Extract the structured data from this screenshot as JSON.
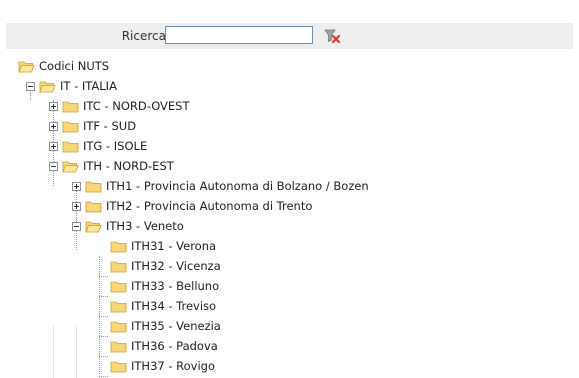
{
  "search": {
    "label": "Ricerca",
    "value": "",
    "placeholder": "",
    "clear_icon": "clear-filter-icon"
  },
  "tree": {
    "root": "Codici NUTS",
    "nodes": [
      {
        "label": "IT - ITALIA",
        "level": 1,
        "state": "expanded"
      },
      {
        "label": "ITC - NORD-OVEST",
        "level": 2,
        "state": "collapsed"
      },
      {
        "label": "ITF - SUD",
        "level": 2,
        "state": "collapsed"
      },
      {
        "label": "ITG - ISOLE",
        "level": 2,
        "state": "collapsed"
      },
      {
        "label": "ITH - NORD-EST",
        "level": 2,
        "state": "expanded"
      },
      {
        "label": "ITH1 - Provincia Autonoma di Bolzano / Bozen",
        "level": 3,
        "state": "collapsed"
      },
      {
        "label": "ITH2 - Provincia Autonoma di Trento",
        "level": 3,
        "state": "collapsed"
      },
      {
        "label": "ITH3 - Veneto",
        "level": 3,
        "state": "expanded"
      },
      {
        "label": "ITH31 - Verona",
        "level": 4,
        "state": "leaf"
      },
      {
        "label": "ITH32 - Vicenza",
        "level": 4,
        "state": "leaf"
      },
      {
        "label": "ITH33 - Belluno",
        "level": 4,
        "state": "leaf"
      },
      {
        "label": "ITH34 - Treviso",
        "level": 4,
        "state": "leaf"
      },
      {
        "label": "ITH35 - Venezia",
        "level": 4,
        "state": "leaf"
      },
      {
        "label": "ITH36 - Padova",
        "level": 4,
        "state": "leaf"
      },
      {
        "label": "ITH37 - Rovigo",
        "level": 4,
        "state": "leaf"
      }
    ]
  },
  "colors": {
    "folder_fill": "#f6d679",
    "folder_stroke": "#c9a02d",
    "input_border": "#6b8fb5",
    "search_bar_bg": "#ededed"
  }
}
